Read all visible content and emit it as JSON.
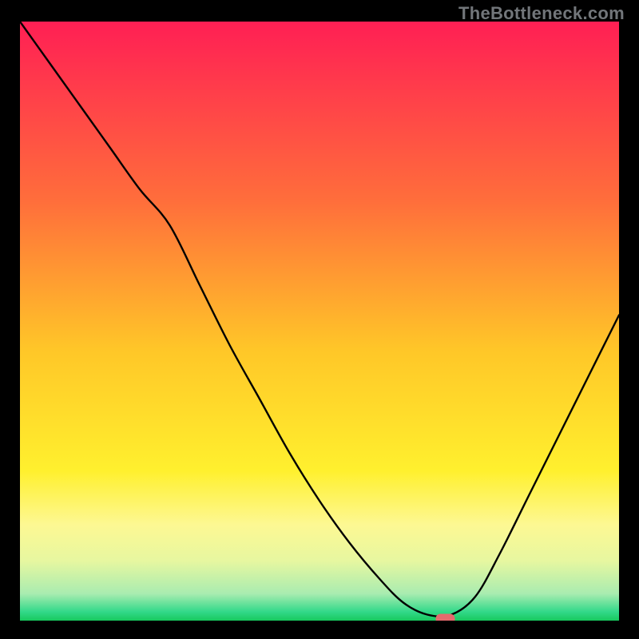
{
  "watermark": "TheBottleneck.com",
  "chart_data": {
    "type": "line",
    "title": "",
    "xlabel": "",
    "ylabel": "",
    "xlim": [
      0,
      100
    ],
    "ylim": [
      0,
      100
    ],
    "grid": false,
    "legend": false,
    "series": [
      {
        "name": "bottleneck-curve",
        "x": [
          0,
          5,
          10,
          15,
          20,
          25,
          30,
          35,
          40,
          45,
          50,
          55,
          60,
          64,
          68,
          72,
          76,
          80,
          85,
          90,
          95,
          100
        ],
        "y": [
          100,
          93,
          86,
          79,
          72,
          66,
          56,
          46,
          37,
          28,
          20,
          13,
          7,
          3,
          1,
          1,
          4,
          11,
          21,
          31,
          41,
          51
        ]
      }
    ],
    "marker": {
      "x": 71,
      "y": 0,
      "color": "#e46a6d"
    },
    "background_gradient": {
      "stops": [
        {
          "pos": 0.0,
          "color": "#ff1f54"
        },
        {
          "pos": 0.3,
          "color": "#ff6e3b"
        },
        {
          "pos": 0.55,
          "color": "#ffc728"
        },
        {
          "pos": 0.75,
          "color": "#fff02e"
        },
        {
          "pos": 0.84,
          "color": "#fdf893"
        },
        {
          "pos": 0.9,
          "color": "#e7f7a0"
        },
        {
          "pos": 0.955,
          "color": "#a9ecb0"
        },
        {
          "pos": 0.985,
          "color": "#33d98a"
        },
        {
          "pos": 1.0,
          "color": "#17c95d"
        }
      ]
    }
  }
}
